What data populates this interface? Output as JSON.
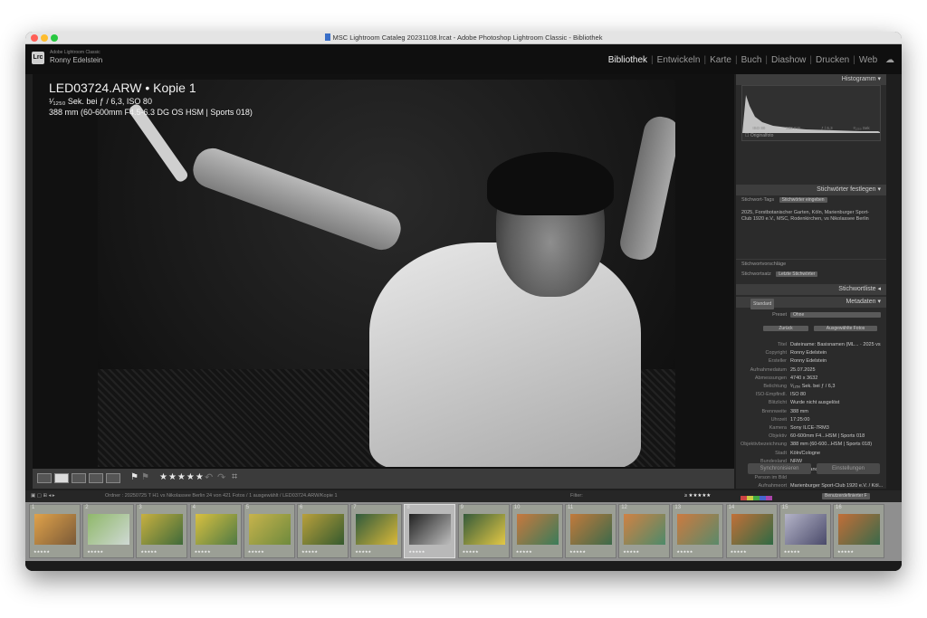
{
  "window": {
    "title": "MSC Lightroom Cataleg 20231108.lrcat - Adobe Photoshop Lightroom Classic - Bibliothek"
  },
  "identity": {
    "product": "Adobe Lightroom Classic",
    "owner": "Ronny Edelstein",
    "logo": "Lrc"
  },
  "modules": [
    "Bibliothek",
    "Entwickeln",
    "Karte",
    "Buch",
    "Diashow",
    "Drucken",
    "Web"
  ],
  "active_module": "Bibliothek",
  "photo_info": {
    "filename": "LED03724.ARW  •  Kopie 1",
    "exposure": "¹⁄₁₂₅₀ Sek. bei ƒ / 6,3, ISO 80",
    "lens": "388 mm (60-600mm F4.5-6.3 DG OS HSM | Sports 018)"
  },
  "toolbar": {
    "stars": "★★★★★",
    "flag": "⚑"
  },
  "right_panel": {
    "histogram_title": "Histogramm",
    "histogram_labels": [
      "ISO 80",
      "388 mm",
      "ƒ / 6,3",
      "¹⁄₁₂₅₀ Sek"
    ],
    "original_photo": "Originalfoto",
    "keywording_title": "Stichwörter festlegen",
    "keyword_tags_label": "Stichwort-Tags",
    "keyword_tags_select": "Stichwörter eingeben",
    "keywords_text": "2025, Forstbotanischer Garten, Köln, Marienburger Sport-Club 1920 e.V., MSC, Rodenkirchen, vs Nikolassee Berlin",
    "keyword_suggestions": "Stichwortvorschläge",
    "keyword_set_label": "Stichwortsatz",
    "keyword_set_value": "Letzte Stichwörter",
    "keyword_list_title": "Stichwortliste",
    "metadata_preset": "Standard",
    "metadata_title": "Metadaten",
    "preset_label": "Preset",
    "preset_value": "Ohne",
    "sync_btn": "Zurück",
    "sync_btn2": "Ausgewählte Fotos",
    "metadata": [
      {
        "label": "Titel",
        "value": "Dateiname: Basisnamen (ML... · 2025 vs"
      },
      {
        "label": "Copyright",
        "value": "Ronny Edelstein"
      },
      {
        "label": "Ersteller",
        "value": "Ronny Edelstein"
      },
      {
        "label": "Aufnahmedatum",
        "value": "25.07.2025"
      },
      {
        "label": "Abmessungen",
        "value": "4740 x 3632"
      },
      {
        "label": "Belichtung",
        "value": "¹⁄₁₂₅₀ Sek. bei ƒ / 6,3"
      },
      {
        "label": "ISO-Empfindl.",
        "value": "ISO 80"
      },
      {
        "label": "Blitzlicht",
        "value": "Wurde nicht ausgelöst"
      },
      {
        "label": "Brennweite",
        "value": "388 mm"
      },
      {
        "label": "Uhrzeit",
        "value": "17:25:00"
      },
      {
        "label": "Kamera",
        "value": "Sony ILCE-7RM3"
      },
      {
        "label": "Objektiv",
        "value": "60-600mm F4...HSM | Sports 018"
      },
      {
        "label": "Objektivbezeichnung",
        "value": "388 mm (60-600...HSM | Sports 018)"
      },
      {
        "label": "Stadt",
        "value": "Köln/Cologne"
      },
      {
        "label": "Bundesland",
        "value": "NRW"
      },
      {
        "label": "Land/Region",
        "value": "Deutschland/Germany"
      },
      {
        "label": "Person im Bild",
        "value": ""
      },
      {
        "label": "Aufnahmeort",
        "value": "Marienburger Sport-Club 1920 e.V. / Köl..."
      },
      {
        "label": "Ort",
        "value": "Köln/Cologne"
      }
    ],
    "sync_button": "Synchronisieren",
    "import_button": "Einstellungen"
  },
  "filmstrip_bar": {
    "path": "Ordner : 20250725 T H1 vs Nikolassee Berlin   24 von 421 Fotos / 1 ausgewählt / LED03724.ARW/Kopie 1",
    "filter_label": "Filter:",
    "filter_stars": "≥ ★★★★★",
    "filter_preset": "Benutzerdefinierter F"
  },
  "filmstrip": [
    {
      "num": "1",
      "c1": "#e0a24a",
      "c2": "#7a5a38"
    },
    {
      "num": "2",
      "c1": "#8fb86a",
      "c2": "#cfd9d4"
    },
    {
      "num": "3",
      "c1": "#c8b040",
      "c2": "#3f6a3a"
    },
    {
      "num": "4",
      "c1": "#d9c040",
      "c2": "#4f7a44"
    },
    {
      "num": "5",
      "c1": "#c7b34c",
      "c2": "#6e8a3d"
    },
    {
      "num": "6",
      "c1": "#b9a03c",
      "c2": "#355a2e"
    },
    {
      "num": "7",
      "c1": "#2f5a3d",
      "c2": "#d9b83a"
    },
    {
      "num": "8",
      "c1": "#222222",
      "c2": "#bdbdbd"
    },
    {
      "num": "9",
      "c1": "#345a3a",
      "c2": "#e3c845"
    },
    {
      "num": "10",
      "c1": "#c8783e",
      "c2": "#3a7c5a"
    },
    {
      "num": "11",
      "c1": "#c27a3c",
      "c2": "#3c6a4a"
    },
    {
      "num": "12",
      "c1": "#d08244",
      "c2": "#4d8a6a"
    },
    {
      "num": "13",
      "c1": "#cc7a40",
      "c2": "#5a8a6a"
    },
    {
      "num": "14",
      "c1": "#c27038",
      "c2": "#2f6a44"
    },
    {
      "num": "15",
      "c1": "#b4b4c8",
      "c2": "#4a4a6a"
    },
    {
      "num": "16",
      "c1": "#c26e38",
      "c2": "#3a6a4a"
    }
  ],
  "thumb_stars": "★★★★★",
  "colors": {
    "accent": "#f0f0f0",
    "panel": "#2b2b2b",
    "strip": "#8f8f8f"
  }
}
